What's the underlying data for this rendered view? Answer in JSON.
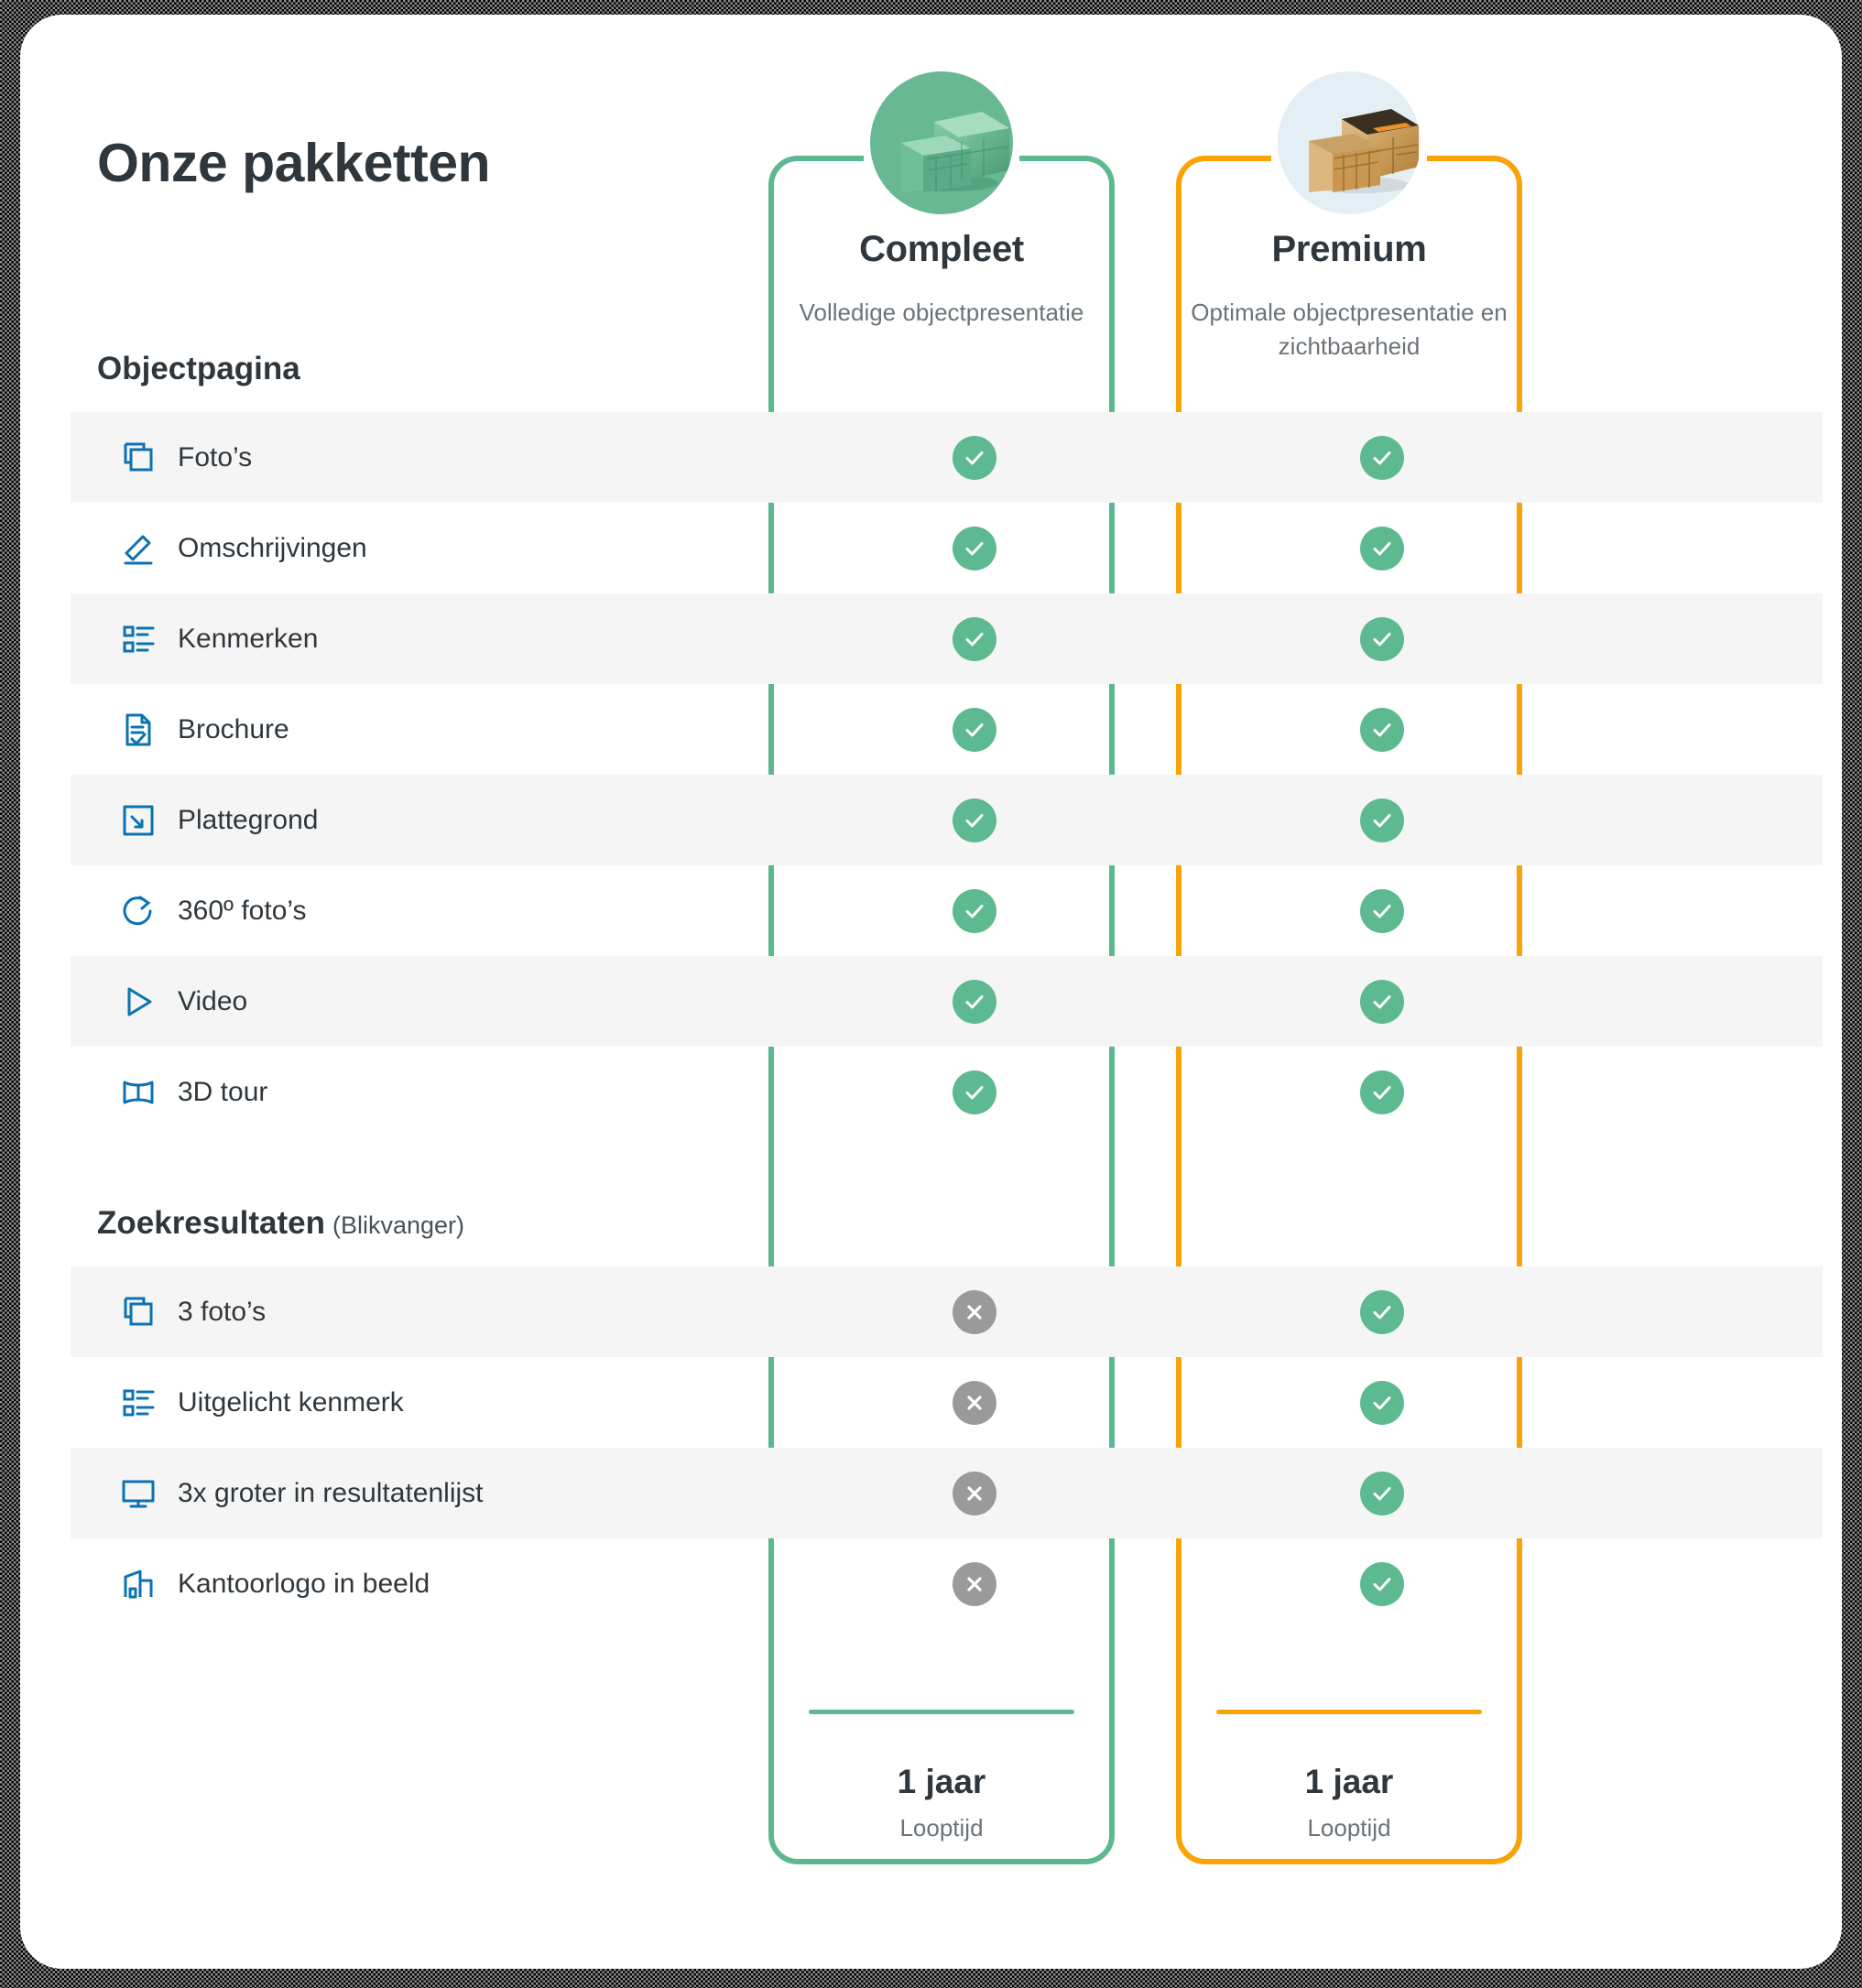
{
  "page": {
    "title": "Onze pakketten"
  },
  "colors": {
    "compleet_accent": "#5cb890",
    "premium_accent": "#f9a307",
    "icon_blue": "#0c72b0",
    "check_green": "#5cb990",
    "cross_grey": "#9a9a9a",
    "text_dark": "#30373c",
    "text_muted": "#6c7378",
    "row_stripe": "#f5f5f5"
  },
  "plans": [
    {
      "id": "compleet",
      "name": "Compleet",
      "subtitle": "Volledige objectpresentatie",
      "badge_icon": "stacked-boxes-green-icon",
      "term_value": "1 jaar",
      "term_label": "Looptijd"
    },
    {
      "id": "premium",
      "name": "Premium",
      "subtitle": "Optimale objectpresentatie en zichtbaarheid",
      "badge_icon": "stacked-boxes-cardboard-icon",
      "term_value": "1 jaar",
      "term_label": "Looptijd"
    }
  ],
  "sections": [
    {
      "id": "objectpagina",
      "heading": "Objectpagina",
      "note": "",
      "rows": [
        {
          "label": "Foto’s",
          "icon": "photos-icon",
          "compleet": "yes",
          "premium": "yes"
        },
        {
          "label": "Omschrijvingen",
          "icon": "pencil-icon",
          "compleet": "yes",
          "premium": "yes"
        },
        {
          "label": "Kenmerken",
          "icon": "list-icon",
          "compleet": "yes",
          "premium": "yes"
        },
        {
          "label": "Brochure",
          "icon": "document-check-icon",
          "compleet": "yes",
          "premium": "yes"
        },
        {
          "label": "Plattegrond",
          "icon": "floorplan-icon",
          "compleet": "yes",
          "premium": "yes"
        },
        {
          "label": "360º foto’s",
          "icon": "rotate-360-icon",
          "compleet": "yes",
          "premium": "yes"
        },
        {
          "label": "Video",
          "icon": "play-icon",
          "compleet": "yes",
          "premium": "yes"
        },
        {
          "label": "3D tour",
          "icon": "panorama-icon",
          "compleet": "yes",
          "premium": "yes"
        }
      ]
    },
    {
      "id": "zoekresultaten",
      "heading": "Zoekresultaten",
      "note": "(Blikvanger)",
      "rows": [
        {
          "label": "3 foto’s",
          "icon": "photos-icon",
          "compleet": "no",
          "premium": "yes"
        },
        {
          "label": "Uitgelicht kenmerk",
          "icon": "list-icon",
          "compleet": "no",
          "premium": "yes"
        },
        {
          "label": "3x groter in resultatenlijst",
          "icon": "monitor-icon",
          "compleet": "no",
          "premium": "yes"
        },
        {
          "label": "Kantoorlogo in beeld",
          "icon": "building-icon",
          "compleet": "no",
          "premium": "yes"
        }
      ]
    }
  ]
}
